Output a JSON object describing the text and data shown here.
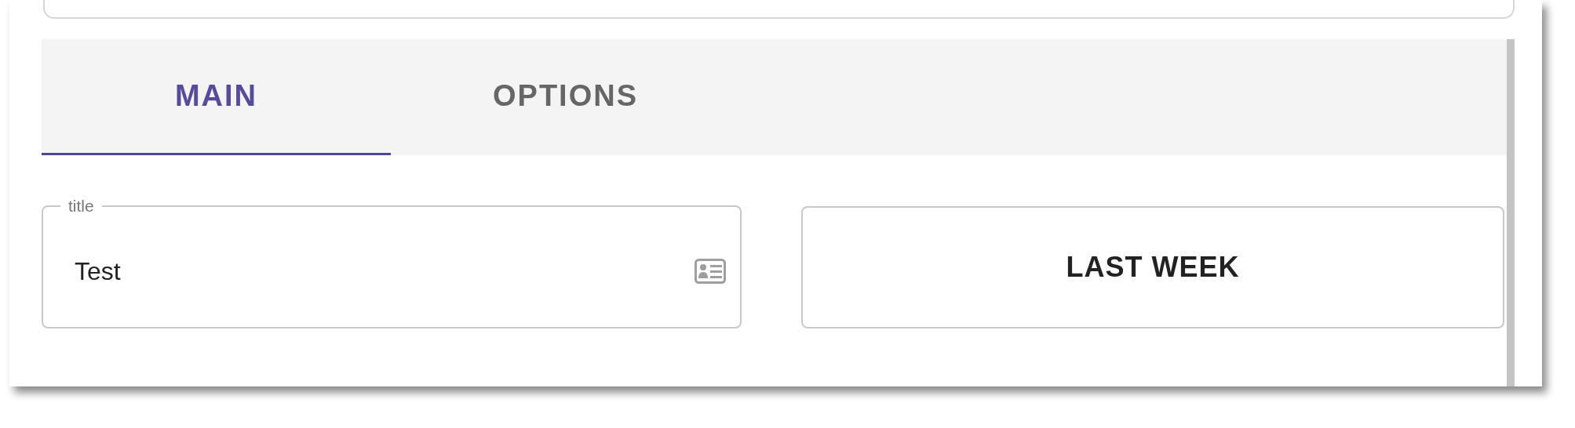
{
  "tabs": [
    {
      "label": "MAIN",
      "selected": true
    },
    {
      "label": "OPTIONS",
      "selected": false
    }
  ],
  "title_field": {
    "label": "title",
    "value": "Test"
  },
  "period_button": {
    "label": "LAST WEEK"
  }
}
